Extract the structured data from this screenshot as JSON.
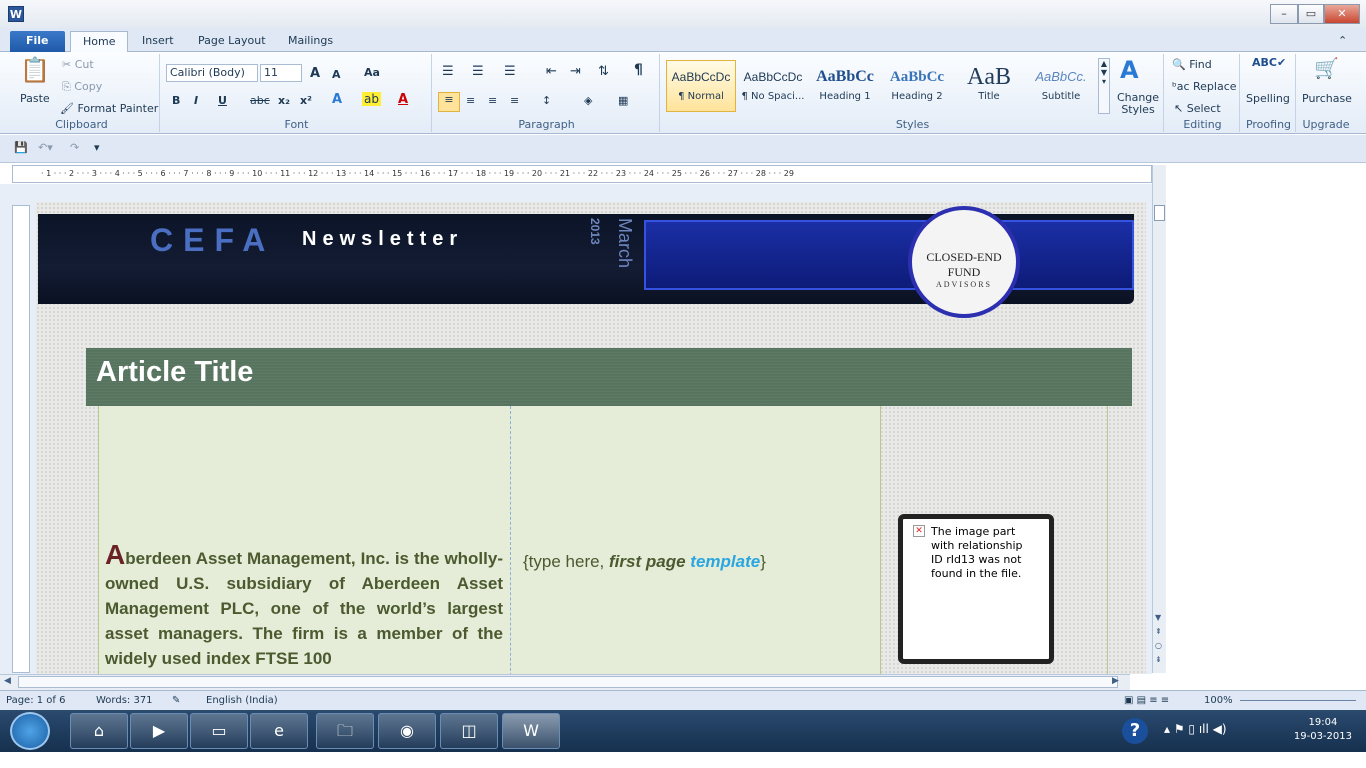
{
  "app": {
    "icon": "W",
    "window_controls": [
      "–",
      "▭",
      "✕"
    ]
  },
  "tabs": [
    "File",
    "Home",
    "Insert",
    "Page Layout",
    "Mailings"
  ],
  "clipboard": {
    "paste": "Paste",
    "cut": "Cut",
    "copy": "Copy",
    "format_painter": "Format Painter",
    "label": "Clipboard"
  },
  "font": {
    "family": "Calibri (Body)",
    "size": "11",
    "label": "Font",
    "bold": "B",
    "italic": "I",
    "underline": "U",
    "strike": "abc",
    "sub": "x₂",
    "sup": "x²",
    "grow": "A",
    "shrink": "A",
    "case": "Aa"
  },
  "paragraph": {
    "label": "Paragraph"
  },
  "styles": {
    "label": "Styles",
    "items": [
      {
        "preview": "AaBbCcDc",
        "name": "¶ Normal"
      },
      {
        "preview": "AaBbCcDc",
        "name": "¶ No Spaci..."
      },
      {
        "preview": "AaBbCc",
        "name": "Heading 1"
      },
      {
        "preview": "AaBbCc",
        "name": "Heading 2"
      },
      {
        "preview": "AaB",
        "name": "Title"
      },
      {
        "preview": "AaBbCc.",
        "name": "Subtitle"
      }
    ],
    "change": "Change Styles"
  },
  "editing": {
    "find": "Find",
    "replace": "Replace",
    "select": "Select",
    "label": "Editing"
  },
  "proofing": {
    "spelling": "Spelling",
    "label": "Proofing"
  },
  "upgrade": {
    "purchase": "Purchase",
    "label": "Upgrade"
  },
  "document": {
    "banner_title": "CEFA",
    "banner_sub": "Newsletter",
    "banner_date_month": "March",
    "banner_date_year": "2013",
    "logo_text": "CLOSED-END FUND",
    "logo_sub": "ADVISORS",
    "article_title": "Article Title",
    "dropcap": "A",
    "body": "berdeen Asset Management, Inc. is the wholly-owned U.S. subsidiary of Aberdeen Asset Management PLC, one of the world’s largest asset managers. The firm is a member of the widely used index FTSE 100",
    "col2_prefix": "{type here, ",
    "col2_italic": "first page",
    "col2_link": "template",
    "col2_suffix": "}",
    "image_error": "The image part with relationship ID rId13 was not found in the file."
  },
  "status": {
    "page": "Page: 1 of 6",
    "words": "Words: 371",
    "language": "English (India)",
    "zoom": "100%"
  },
  "taskbar": {
    "time": "19:04",
    "date": "19-03-2013"
  }
}
